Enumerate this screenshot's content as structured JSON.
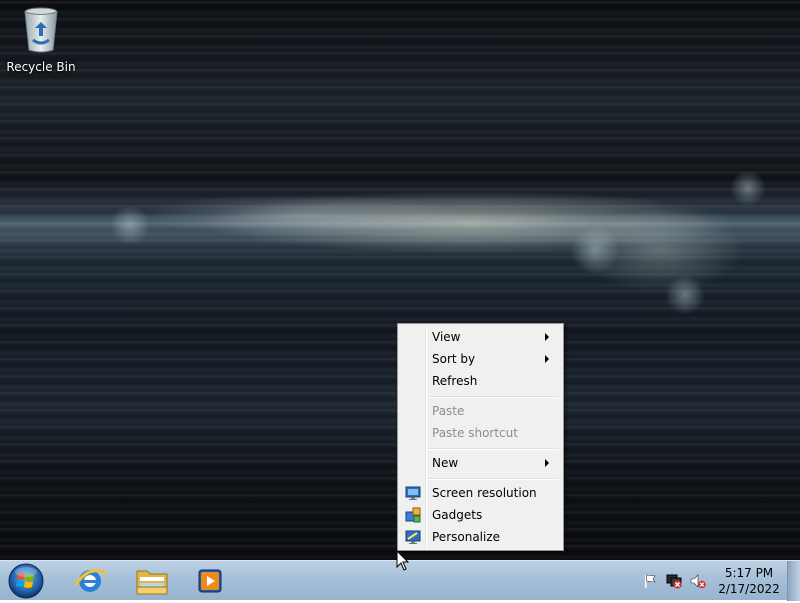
{
  "desktop": {
    "icons": [
      {
        "label": "Recycle Bin",
        "icon": "recycle-bin-icon"
      }
    ]
  },
  "context_menu": {
    "items": [
      {
        "label": "View",
        "submenu": true,
        "disabled": false
      },
      {
        "label": "Sort by",
        "submenu": true,
        "disabled": false
      },
      {
        "label": "Refresh",
        "submenu": false,
        "disabled": false
      },
      {
        "label": "Paste",
        "submenu": false,
        "disabled": true
      },
      {
        "label": "Paste shortcut",
        "submenu": false,
        "disabled": true
      },
      {
        "label": "New",
        "submenu": true,
        "disabled": false
      },
      {
        "label": "Screen resolution",
        "icon": "screen-resolution-icon",
        "disabled": false
      },
      {
        "label": "Gadgets",
        "icon": "gadgets-icon",
        "disabled": false
      },
      {
        "label": "Personalize",
        "icon": "personalize-icon",
        "disabled": false
      }
    ]
  },
  "taskbar": {
    "start_icon": "windows-start-icon",
    "pinned": [
      {
        "name": "internet-explorer",
        "icon": "internet-explorer-icon"
      },
      {
        "name": "windows-explorer",
        "icon": "folder-icon"
      },
      {
        "name": "media-player",
        "icon": "media-player-icon"
      }
    ],
    "tray_icons": [
      "action-center-flag-icon",
      "network-disconnected-icon",
      "volume-muted-icon"
    ],
    "clock": {
      "time": "5:17 PM",
      "date": "2/17/2022"
    }
  },
  "colors": {
    "menu_bg": "#f0f0f0",
    "menu_border": "#979797",
    "disabled_text": "#8d8d8d",
    "taskbar": "#a7c0d8"
  }
}
